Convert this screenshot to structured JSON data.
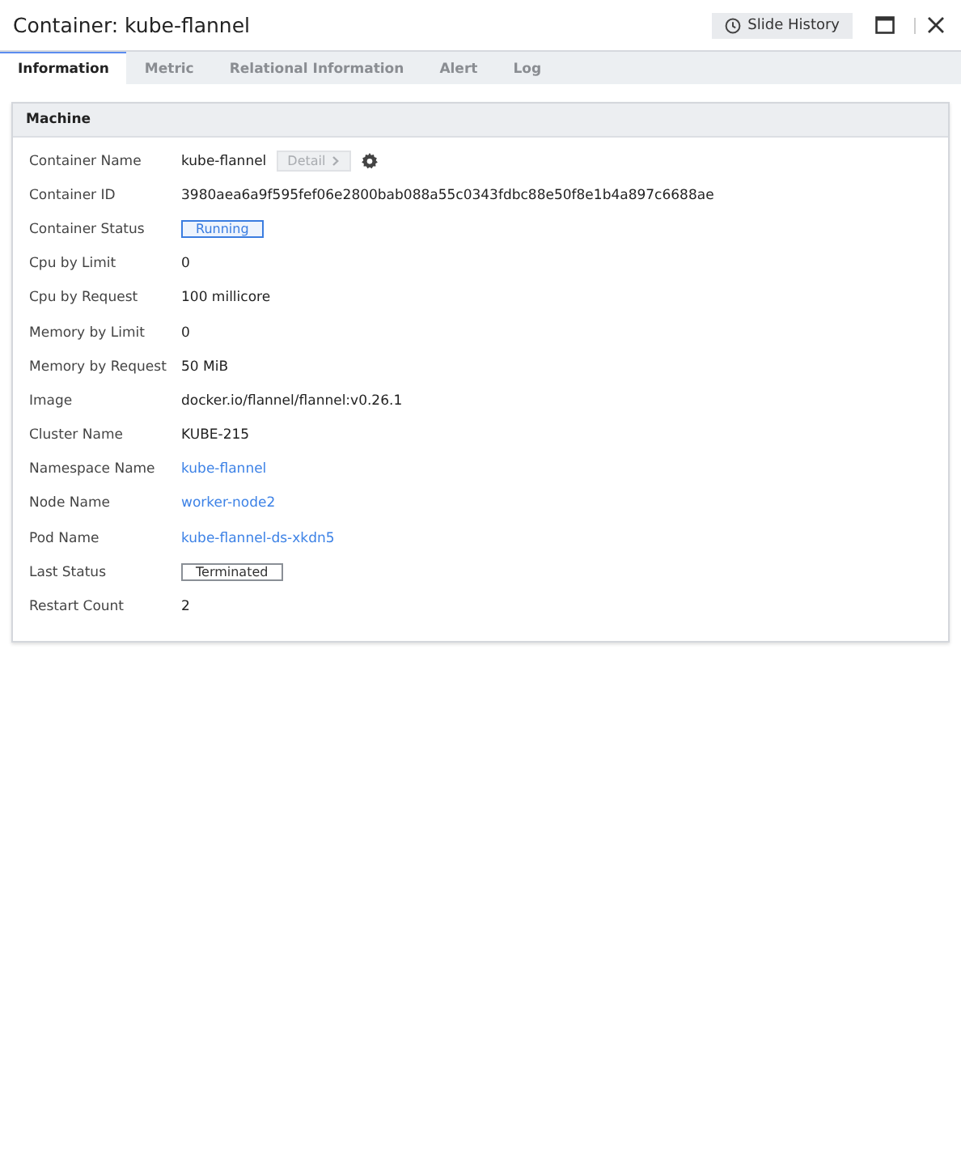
{
  "window": {
    "title": "Container: kube-flannel",
    "history_button": "Slide History"
  },
  "tabs": [
    {
      "label": "Information",
      "selected": true
    },
    {
      "label": "Metric",
      "selected": false
    },
    {
      "label": "Relational Information",
      "selected": false
    },
    {
      "label": "Alert",
      "selected": false
    },
    {
      "label": "Log",
      "selected": false
    }
  ],
  "panel": {
    "title": "Machine",
    "rows": [
      {
        "label": "Container Name",
        "kind": "detail",
        "value": "kube-flannel",
        "button": {
          "label": "Detail",
          "disabled": true
        }
      },
      {
        "label": "Container ID",
        "kind": "text",
        "value": "3980aea6a9f595fef06e2800bab088a55c0343fdbc88e50f8e1b4a897c6688ae"
      },
      {
        "label": "Container Status",
        "kind": "badge",
        "value": "Running",
        "color": "#3b7de0"
      },
      {
        "label": "Cpu by Limit",
        "kind": "text",
        "value": "0"
      },
      {
        "label": "Cpu by Request",
        "kind": "text",
        "value": "100 millicore"
      },
      {
        "label": "Memory by Limit",
        "kind": "text",
        "value": "0"
      },
      {
        "label": "Memory by Request",
        "kind": "text",
        "value": "50 MiB"
      },
      {
        "label": "Image",
        "kind": "text",
        "value": "docker.io/flannel/flannel:v0.26.1"
      },
      {
        "label": "Cluster Name",
        "kind": "text",
        "value": "KUBE-215"
      },
      {
        "label": "Namespace Name",
        "kind": "link",
        "value": "kube-flannel"
      },
      {
        "label": "Node Name",
        "kind": "link",
        "value": "worker-node2"
      },
      {
        "label": "Pod Name",
        "kind": "link",
        "value": "kube-flannel-ds-xkdn5"
      },
      {
        "label": "Last Status",
        "kind": "badge",
        "value": "Terminated",
        "color": "#8a8f96"
      },
      {
        "label": "Restart Count",
        "kind": "text",
        "value": "2"
      }
    ]
  }
}
